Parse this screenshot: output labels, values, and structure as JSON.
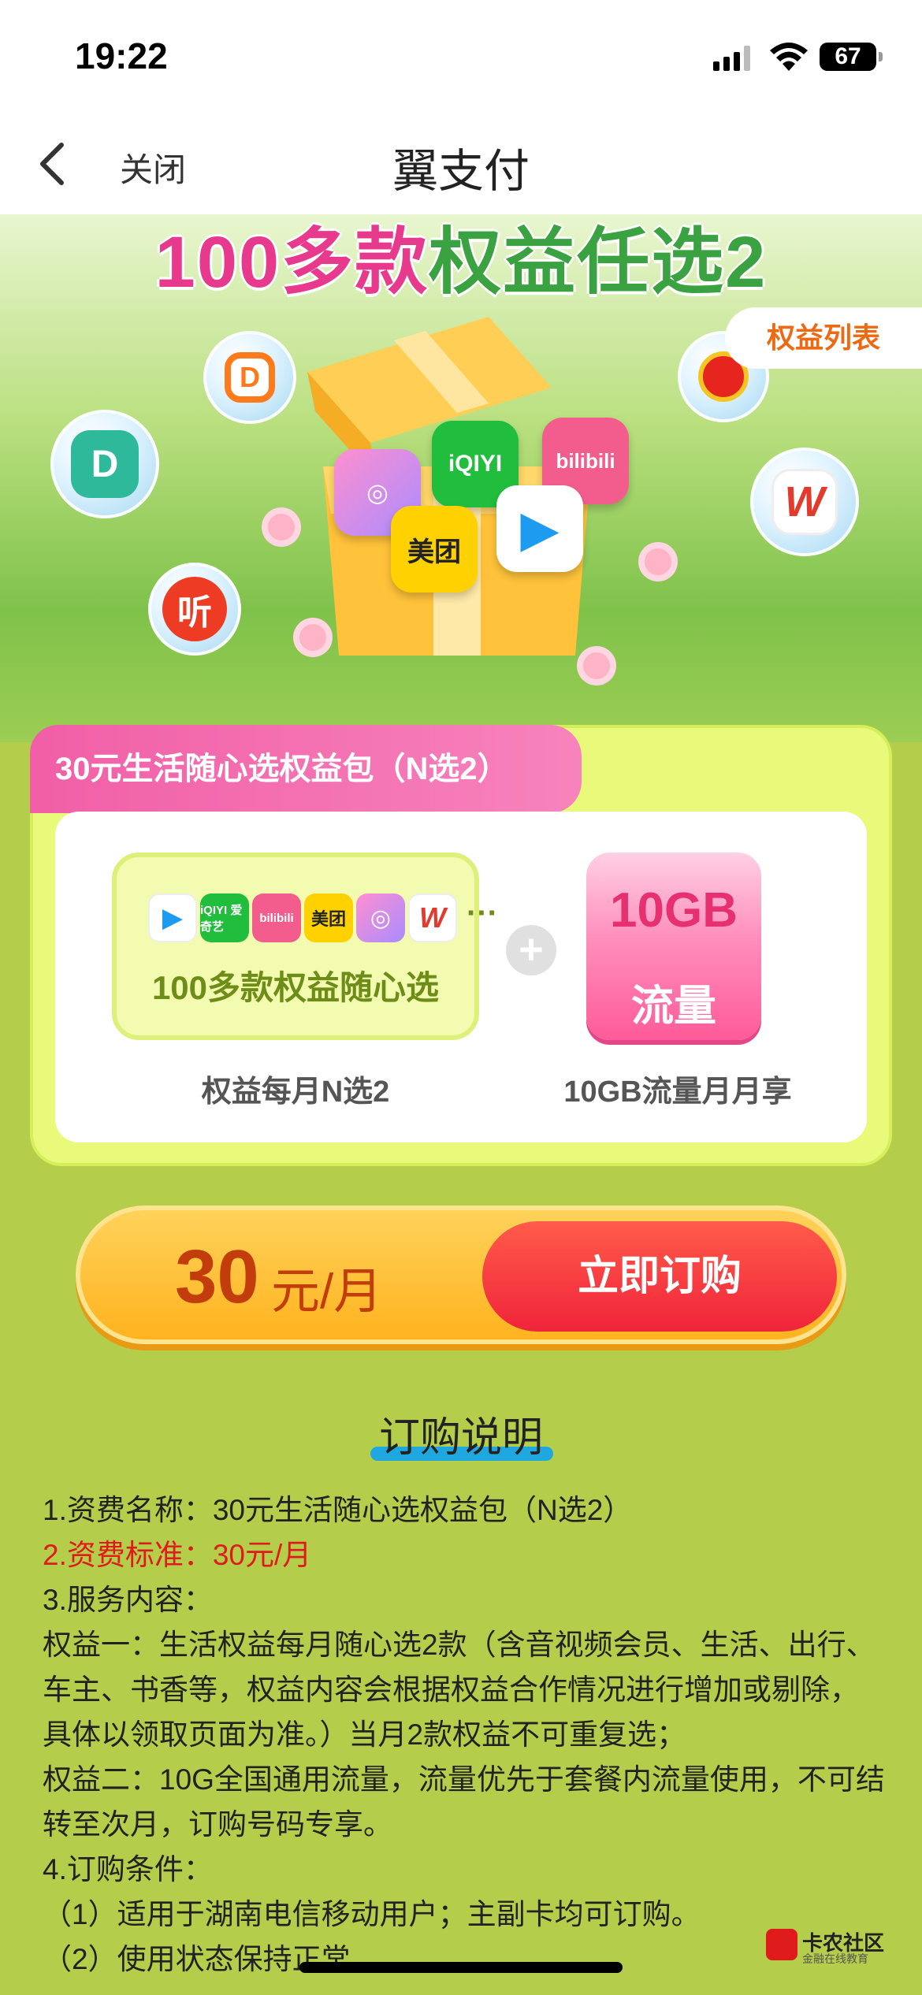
{
  "status_bar": {
    "time": "19:22",
    "battery": "67"
  },
  "nav": {
    "back_icon": "chevron-left-icon",
    "close_label": "关闭",
    "title": "翼支付"
  },
  "hero": {
    "title_part1": "100多款",
    "title_part2": "权益任选2",
    "tag_label": "权益列表",
    "apps": [
      "iQIYI",
      "bilibili",
      "美团",
      "腾讯视频",
      "美图"
    ],
    "bubbles": [
      "didi-icon",
      "didi-green-icon",
      "ting-icon",
      "petrochina-icon",
      "wps-icon"
    ]
  },
  "package": {
    "tab_title": "30元生活随心选权益包（N选2）",
    "feature1_text": "100多款权益随心选",
    "feature1_caption": "权益每月N选2",
    "mini_icons": [
      "腾讯视频",
      "iQIYI 爱奇艺",
      "bilibili",
      "美团",
      "美图",
      "WPS"
    ],
    "more": "···",
    "plus": "+",
    "feature2_big": "10GB",
    "feature2_small": "流量",
    "feature2_caption": "10GB流量月月享"
  },
  "price": {
    "amount": "30",
    "unit": "元/月",
    "buy_label": "立即订购"
  },
  "description": {
    "title": "订购说明",
    "lines": [
      "1.资费名称：30元生活随心选权益包（N选2）",
      "2.资费标准：30元/月",
      "3.服务内容：",
      "权益一：生活权益每月随心选2款（含音视频会员、生活、出行、车主、书香等，权益内容会根据权益合作情况进行增加或剔除，具体以领取页面为准。）当月2款权益不可重复选；",
      "权益二：10G全国通用流量，流量优先于套餐内流量使用，不可结转至次月，订购号码专享。",
      "4.订购条件：",
      "（1）适用于湖南电信移动用户；主副卡均可订购。",
      "（2）使用状态保持正常"
    ]
  },
  "watermark": {
    "name": "卡农社区",
    "slogan": "金融在线教育"
  },
  "colors": {
    "accent_green": "#b4cd4a",
    "pink": "#f15fa6",
    "orange": "#ffb31f",
    "red": "#f0243a"
  }
}
